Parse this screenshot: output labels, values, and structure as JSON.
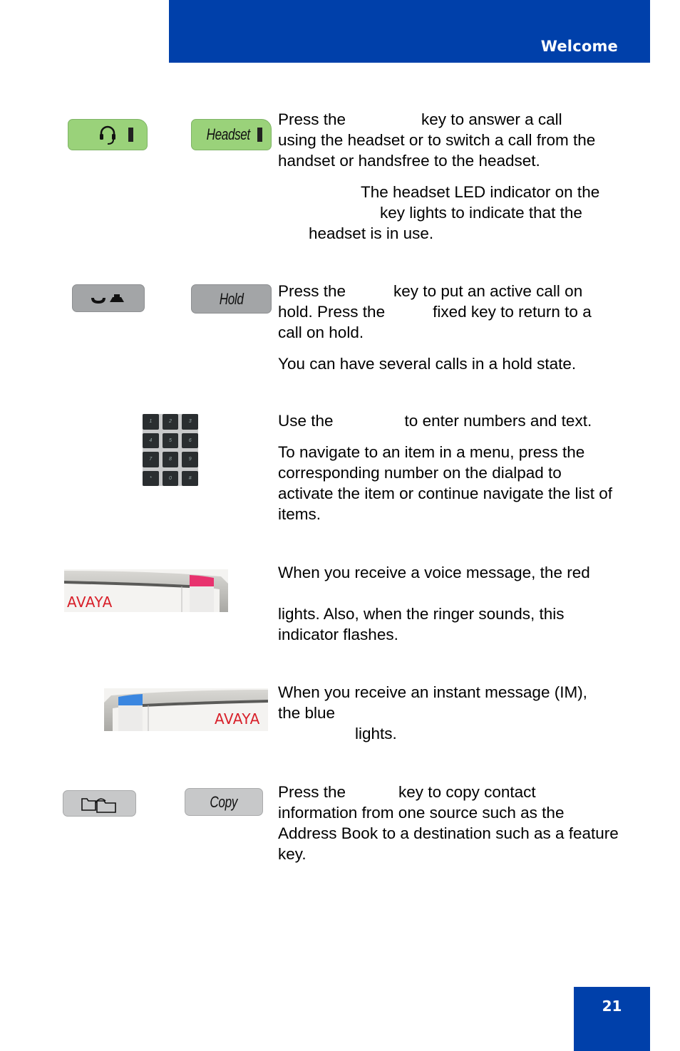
{
  "header": {
    "title": "Welcome"
  },
  "footer": {
    "page_number": "21"
  },
  "colors": {
    "brand_blue": "#0040aa",
    "headset_key_green": "#9ad27a",
    "key_gray": "#a3a5a7",
    "avaya_red": "#d8202a",
    "message_led_red": "#e8326e",
    "im_led_blue": "#3a86e0"
  },
  "sections": [
    {
      "id": "headset",
      "keys": [
        {
          "icon": "headset-icon",
          "label": ""
        },
        {
          "icon": "",
          "label": "Headset"
        }
      ],
      "paragraphs": [
        "Press the key to answer a call using the headset or to switch a call from the handset or handsfree to the headset.",
        "The headset LED indicator on the key lights to indicate that the headset is in use."
      ],
      "lines": {
        "p1_a": "Press the",
        "p1_b": "key to answer a call",
        "p1_c": "using the headset or to switch a call from the",
        "p1_d": "handset or handsfree to the headset.",
        "p2_a": "The headset LED indicator on the",
        "p2_b": "key lights to indicate that the",
        "p2_c": "headset is in use."
      }
    },
    {
      "id": "hold",
      "keys": [
        {
          "icon": "hold-handset-icon",
          "label": ""
        },
        {
          "icon": "",
          "label": "Hold"
        }
      ],
      "lines": {
        "p1_a": "Press the",
        "p1_b": "key to put an active call on",
        "p1_c": "hold. Press the",
        "p1_d": "fixed key to return to a",
        "p1_e": "call on hold.",
        "p2": "You can have several calls in a hold state."
      }
    },
    {
      "id": "dialpad",
      "keys": [
        "1",
        "2",
        "3",
        "4",
        "5",
        "6",
        "7",
        "8",
        "9",
        "*",
        "0",
        "#"
      ],
      "lines": {
        "p1_a": "Use the",
        "p1_b": "to enter numbers and text.",
        "p2": "To navigate to an item in a menu, press the corresponding number on the dialpad to activate the item or continue navigate the list of items."
      }
    },
    {
      "id": "message-indicator",
      "brand": "AVAYA",
      "lines": {
        "p1_a": "When you receive a voice message, the red",
        "p1_b": "lights. Also, when the ringer sounds, this indicator flashes."
      }
    },
    {
      "id": "im-indicator",
      "brand": "AVAYA",
      "lines": {
        "p1_a": "When you receive an instant message (IM),",
        "p1_b": "the blue",
        "p1_c": "lights."
      }
    },
    {
      "id": "copy",
      "keys": [
        {
          "icon": "copy-folders-icon",
          "label": ""
        },
        {
          "icon": "",
          "label": "Copy"
        }
      ],
      "lines": {
        "p1_a": "Press the",
        "p1_b": "key to copy contact",
        "p1_c": "information from one source such as the Address Book to a destination such as a feature key."
      }
    }
  ]
}
